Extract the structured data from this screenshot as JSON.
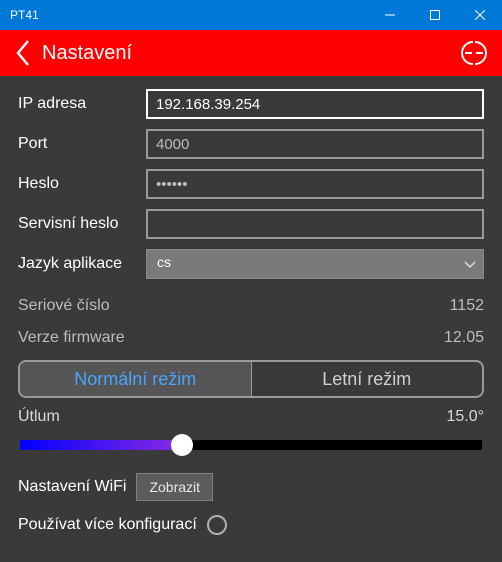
{
  "window": {
    "title": "PT41"
  },
  "header": {
    "title": "Nastavení"
  },
  "fields": {
    "ip_label": "IP adresa",
    "ip_value": "192.168.39.254",
    "port_label": "Port",
    "port_placeholder": "4000",
    "password_label": "Heslo",
    "password_value": "••••••",
    "service_password_label": "Servisní heslo",
    "service_password_value": "",
    "language_label": "Jazyk aplikace",
    "language_value": "cs"
  },
  "readonly": {
    "serial_label": "Seriové číslo",
    "serial_value": "1152",
    "firmware_label": "Verze firmware",
    "firmware_value": "12.05"
  },
  "mode": {
    "normal": "Normální režim",
    "summer": "Letní režim"
  },
  "attenuation": {
    "label": "Útlum",
    "value": "15.0°"
  },
  "wifi": {
    "label": "Nastavení WiFi",
    "button": "Zobrazit"
  },
  "multi_config": {
    "label": "Používat více konfigurací"
  }
}
